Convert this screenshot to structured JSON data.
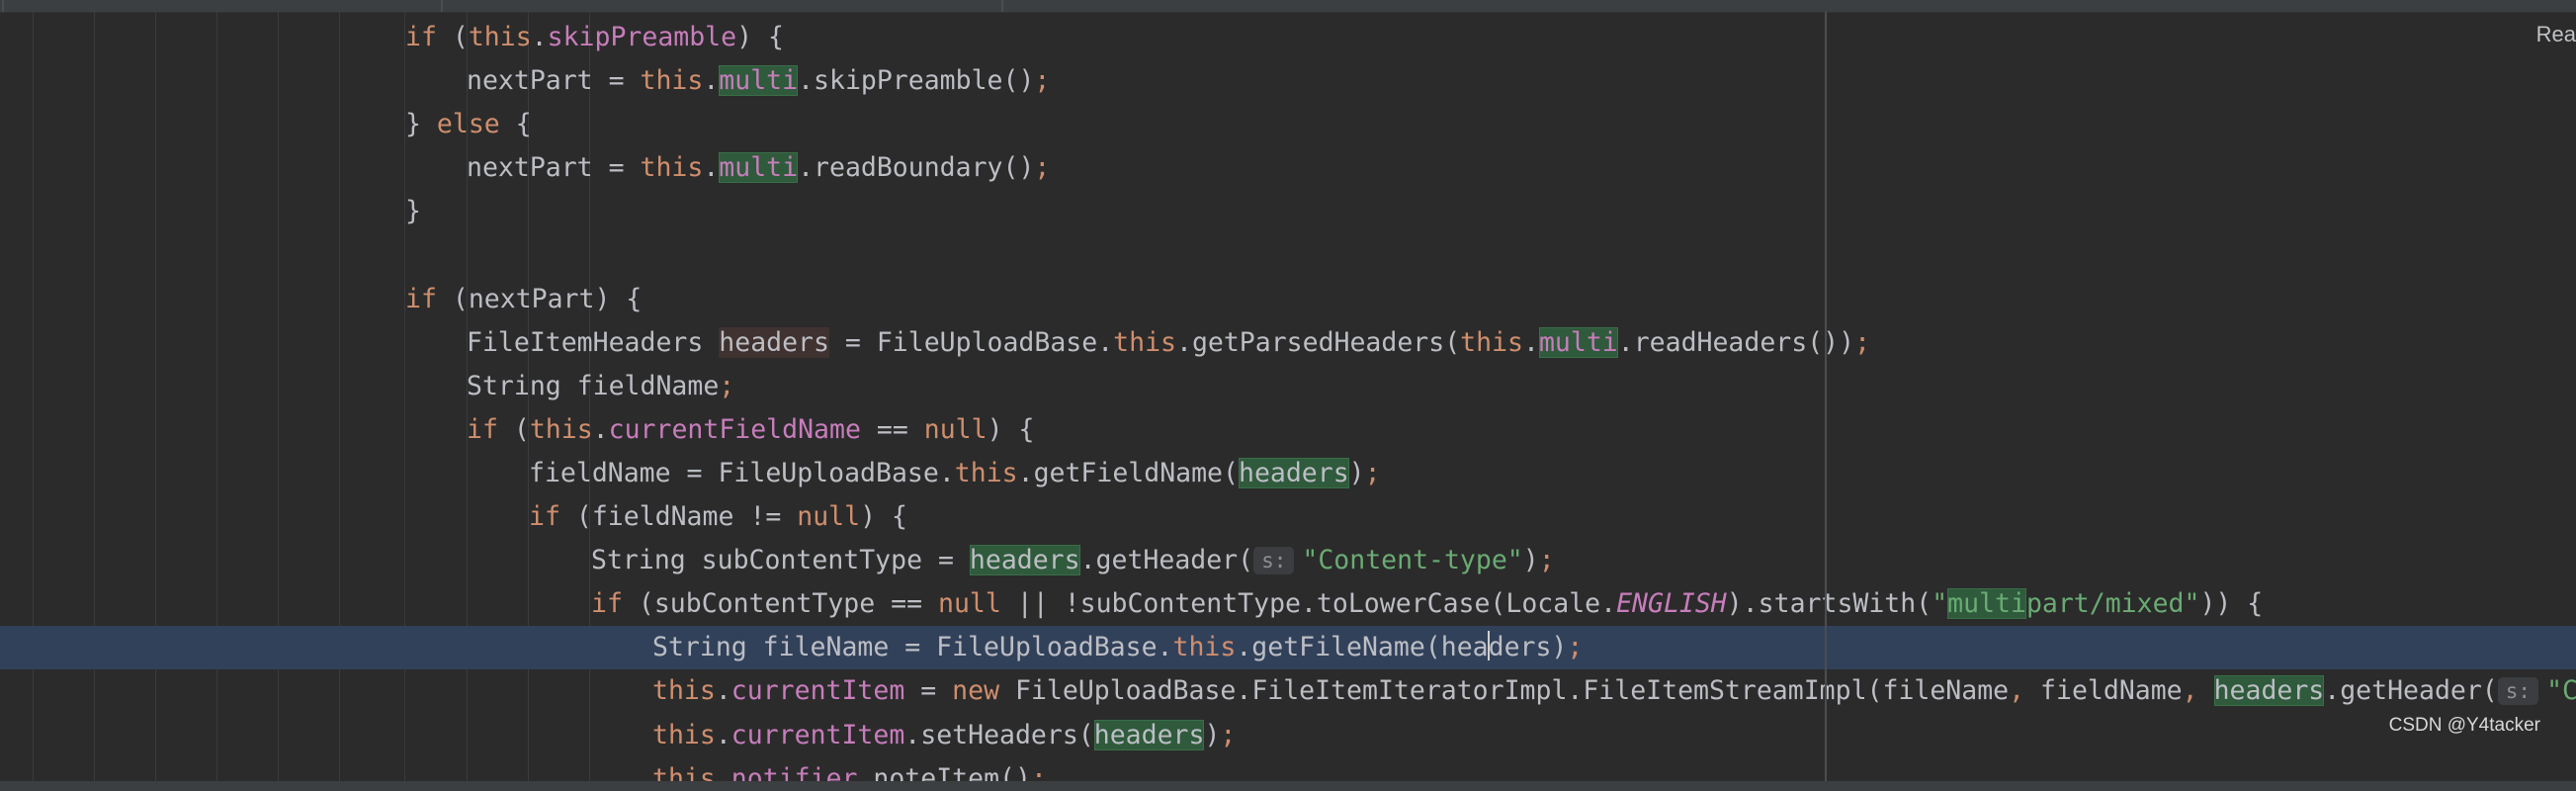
{
  "editor": {
    "reader_mode_label": "Rea",
    "watermark": "CSDN @Y4tacker"
  },
  "lines": [
    [
      [
        "k",
        "if"
      ],
      [
        "p",
        " ("
      ],
      [
        "k",
        "this"
      ],
      [
        "p",
        "."
      ],
      [
        "f",
        "skipPreamble"
      ],
      [
        "p",
        ") {"
      ]
    ],
    [
      [
        "p",
        "nextPart = "
      ],
      [
        "k",
        "this"
      ],
      [
        "p",
        "."
      ],
      [
        "f hlg",
        "multi"
      ],
      [
        "p",
        ".skipPreamble()"
      ],
      [
        "semi",
        ";"
      ]
    ],
    [
      [
        "p",
        "} "
      ],
      [
        "k",
        "else"
      ],
      [
        "p",
        " {"
      ]
    ],
    [
      [
        "p",
        "nextPart = "
      ],
      [
        "k",
        "this"
      ],
      [
        "p",
        "."
      ],
      [
        "f hlg",
        "multi"
      ],
      [
        "p",
        ".readBoundary()"
      ],
      [
        "semi",
        ";"
      ]
    ],
    [
      [
        "p",
        "}"
      ]
    ],
    [],
    [
      [
        "k",
        "if"
      ],
      [
        "p",
        " (nextPart) {"
      ]
    ],
    [
      [
        "p",
        "FileItemHeaders "
      ],
      [
        "p hlr",
        "headers"
      ],
      [
        "p",
        " = FileUploadBase."
      ],
      [
        "k",
        "this"
      ],
      [
        "p",
        ".getParsedHeaders("
      ],
      [
        "k",
        "this"
      ],
      [
        "p",
        "."
      ],
      [
        "f hlg",
        "multi"
      ],
      [
        "p",
        ".readHeaders())"
      ],
      [
        "semi",
        ";"
      ]
    ],
    [
      [
        "p",
        "String fieldName"
      ],
      [
        "semi",
        ";"
      ]
    ],
    [
      [
        "k",
        "if"
      ],
      [
        "p",
        " ("
      ],
      [
        "k",
        "this"
      ],
      [
        "p",
        "."
      ],
      [
        "f",
        "currentFieldName"
      ],
      [
        "p",
        " == "
      ],
      [
        "k",
        "null"
      ],
      [
        "p",
        ") {"
      ]
    ],
    [
      [
        "p",
        "fieldName = FileUploadBase."
      ],
      [
        "k",
        "this"
      ],
      [
        "p",
        ".getFieldName("
      ],
      [
        "p hlg",
        "headers"
      ],
      [
        "p",
        ")"
      ],
      [
        "semi",
        ";"
      ]
    ],
    [
      [
        "k",
        "if"
      ],
      [
        "p",
        " (fieldName != "
      ],
      [
        "k",
        "null"
      ],
      [
        "p",
        ") {"
      ]
    ],
    [
      [
        "p",
        "String subContentType = "
      ],
      [
        "p hlg",
        "headers"
      ],
      [
        "p",
        ".getHeader("
      ],
      [
        "hint",
        "s:"
      ],
      [
        "s",
        "\"Content-type\""
      ],
      [
        "p",
        ")"
      ],
      [
        "semi",
        ";"
      ]
    ],
    [
      [
        "k",
        "if"
      ],
      [
        "p",
        " (subContentType == "
      ],
      [
        "k",
        "null"
      ],
      [
        "p",
        " || !subContentType.toLowerCase(Locale."
      ],
      [
        "e",
        "ENGLISH"
      ],
      [
        "p",
        ").startsWith("
      ],
      [
        "s",
        "\""
      ],
      [
        "s hlg",
        "multi"
      ],
      [
        "s",
        "part/mixed\""
      ],
      [
        "p",
        ")) {"
      ]
    ],
    [
      [
        "p",
        "String fileName = FileUploadBase."
      ],
      [
        "k",
        "this"
      ],
      [
        "p",
        ".getFileName(hea"
      ],
      [
        "caret",
        ""
      ],
      [
        "p",
        "ders)"
      ],
      [
        "semi",
        ";"
      ]
    ],
    [
      [
        "k",
        "this"
      ],
      [
        "p",
        "."
      ],
      [
        "f",
        "currentItem"
      ],
      [
        "p",
        " = "
      ],
      [
        "k",
        "new"
      ],
      [
        "p",
        " FileUploadBase.FileItemIteratorImpl.FileItemStreamImpl(fileName"
      ],
      [
        "semi",
        ","
      ],
      [
        "p",
        " fieldName"
      ],
      [
        "semi",
        ","
      ],
      [
        "p",
        " "
      ],
      [
        "p hlg",
        "headers"
      ],
      [
        "p",
        ".getHeader("
      ],
      [
        "hint",
        "s:"
      ],
      [
        "s",
        "\"Content-Type\""
      ]
    ],
    [
      [
        "k",
        "this"
      ],
      [
        "p",
        "."
      ],
      [
        "f",
        "currentItem"
      ],
      [
        "p",
        ".setHeaders("
      ],
      [
        "p hlg",
        "headers"
      ],
      [
        "p",
        ")"
      ],
      [
        "semi",
        ";"
      ]
    ],
    [
      [
        "k",
        "this"
      ],
      [
        "p",
        "."
      ],
      [
        "f",
        "notifier"
      ],
      [
        "p",
        ".noteItem()"
      ],
      [
        "semi",
        ";"
      ]
    ]
  ]
}
